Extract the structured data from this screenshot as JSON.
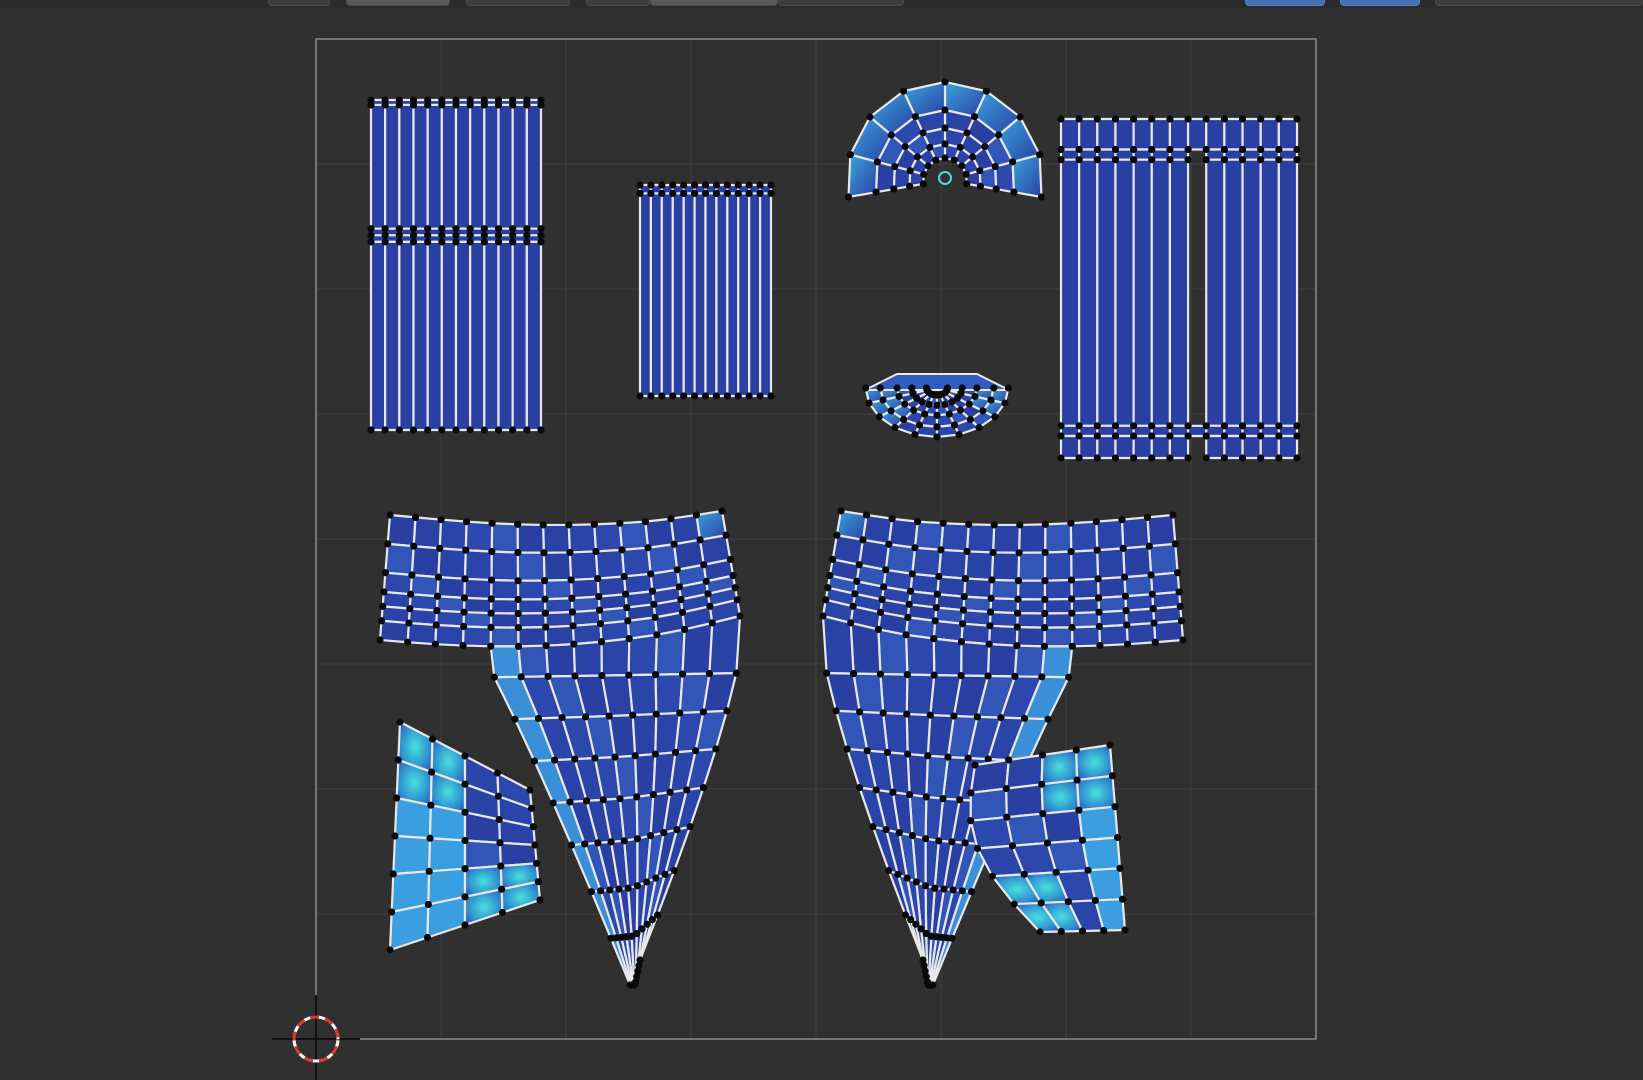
{
  "app": {
    "editor": "UV Editor",
    "background_color": "#303030"
  },
  "header": {
    "buttons": [
      {
        "name": "mode-select-button",
        "icon": "uv-mode-icon",
        "active": false
      },
      {
        "name": "sync-selection-button",
        "icon": "sync-icon",
        "active": false
      },
      {
        "name": "vertex-select-button",
        "icon": "vertex-icon",
        "active": false
      },
      {
        "name": "edge-select-button",
        "icon": "edge-icon",
        "active": false
      },
      {
        "name": "face-select-button",
        "icon": "face-icon",
        "active": false
      },
      {
        "name": "island-select-button",
        "icon": "island-icon",
        "active": false
      },
      {
        "name": "pivot-button",
        "icon": "pivot-icon",
        "active": true
      },
      {
        "name": "snap-button",
        "icon": "magnet-icon",
        "active": true
      }
    ]
  },
  "viewport": {
    "uv_bounds_color": "#8a8a8a",
    "grid_color": "#3e3e3e",
    "island_fill": "#2a3fa2",
    "island_fill_stretched": "#3fc8d8",
    "edge_color": "#e8e8e8",
    "vertex_color": "#0a0a0a",
    "cursor_icon": "2d-cursor-icon"
  },
  "islands": [
    {
      "name": "island-strip-left",
      "stretch": "low"
    },
    {
      "name": "island-strip-center",
      "stretch": "low"
    },
    {
      "name": "island-fan-top",
      "stretch": "medium"
    },
    {
      "name": "island-eye",
      "stretch": "medium"
    },
    {
      "name": "island-strip-right",
      "stretch": "low"
    },
    {
      "name": "island-panel-left",
      "stretch": "low"
    },
    {
      "name": "island-panel-right",
      "stretch": "low"
    },
    {
      "name": "island-patch-left",
      "stretch": "high"
    },
    {
      "name": "island-patch-right",
      "stretch": "high"
    }
  ]
}
